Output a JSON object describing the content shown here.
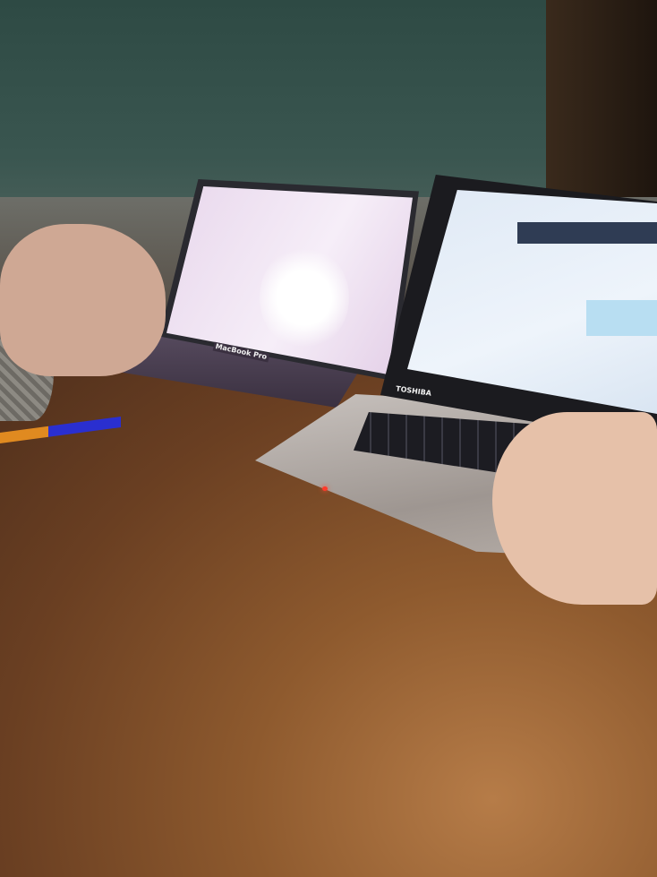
{
  "scene": {
    "description_labels": {
      "left_laptop_logo": "MacBook Pro",
      "right_laptop_logo": "TOSHIBA"
    },
    "colors": {
      "chalkboard": "#3a5650",
      "table": "#8e5a2e",
      "left_screen": "#f0e4f2",
      "right_screen": "#e6eef8",
      "power_led": "#ff3a2a"
    }
  }
}
